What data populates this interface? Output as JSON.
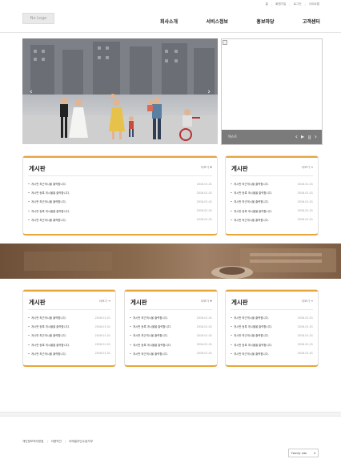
{
  "util_links": [
    "홈",
    "회원가입",
    "로그인",
    "사이트맵"
  ],
  "logo_text": "No Logo",
  "nav": [
    "회사소개",
    "서비스정보",
    "홍보마당",
    "고객센터"
  ],
  "slide_caption": "텍스트",
  "boards": [
    {
      "title": "게시판",
      "more": "더보기 ✚",
      "items": [
        {
          "t": "게시판 최근게시물 출력합니다.",
          "d": "2016.01.01"
        },
        {
          "t": "게시판 등록 게시물을 출력합니다.",
          "d": "2016.01.01"
        },
        {
          "t": "게시판 최근게시물 출력합니다.",
          "d": "2016.01.01"
        },
        {
          "t": "게시판 등록 게시물을 출력합니다.",
          "d": "2016.01.01"
        },
        {
          "t": "게시판 최근게시물 출력합니다.",
          "d": "2016.01.01"
        }
      ]
    },
    {
      "title": "게시판",
      "more": "더보기 ➔",
      "items": [
        {
          "t": "게시판 최근게시물 출력합니다.",
          "d": "2016.01.01"
        },
        {
          "t": "게시판 등록 게시물을 출력합니다.",
          "d": "2016.01.01"
        },
        {
          "t": "게시판 최근게시물 출력합니다.",
          "d": "2016.01.01"
        },
        {
          "t": "게시판 등록 게시물을 출력합니다.",
          "d": "2016.01.01"
        },
        {
          "t": "게시판 최근게시물 출력합니다.",
          "d": "2016.01.01"
        }
      ]
    },
    {
      "title": "게시판",
      "more": "더보기 ➔",
      "items": [
        {
          "t": "게시판 최근게시물 출력합니다.",
          "d": "2016.01.01"
        },
        {
          "t": "게시판 등록 게시물을 출력합니다.",
          "d": "2016.01.01"
        },
        {
          "t": "게시판 최근게시물 출력합니다.",
          "d": "2016.01.01"
        },
        {
          "t": "게시판 등록 게시물을 출력합니다.",
          "d": "2016.01.01"
        },
        {
          "t": "게시판 최근게시물 출력합니다.",
          "d": "2016.01.01"
        }
      ]
    },
    {
      "title": "게시판",
      "more": "더보기 ✚",
      "items": [
        {
          "t": "게시판 최근게시물 출력합니다.",
          "d": "2016.01.01"
        },
        {
          "t": "게시판 등록 게시물을 출력합니다.",
          "d": "2016.01.01"
        },
        {
          "t": "게시판 최근게시물 출력합니다.",
          "d": "2016.01.01"
        },
        {
          "t": "게시판 등록 게시물을 출력합니다.",
          "d": "2016.01.01"
        },
        {
          "t": "게시판 최근게시물 출력합니다.",
          "d": "2016.01.01"
        }
      ]
    },
    {
      "title": "게시판",
      "more": "더보기 ➔",
      "items": [
        {
          "t": "게시판 최근게시물 출력합니다.",
          "d": "2016.01.01"
        },
        {
          "t": "게시판 등록 게시물을 출력합니다.",
          "d": "2016.01.01"
        },
        {
          "t": "게시판 최근게시물 출력합니다.",
          "d": "2016.01.01"
        },
        {
          "t": "게시판 등록 게시물을 출력합니다.",
          "d": "2016.01.01"
        },
        {
          "t": "게시판 최근게시물 출력합니다.",
          "d": "2016.01.01"
        }
      ]
    }
  ],
  "footer_links": [
    "개인정보처리방침",
    "이용약관",
    "이메일무단수집거부"
  ],
  "family_label": "Family site",
  "colors": {
    "accent": "#e8a53a",
    "band": "#7d5e45",
    "slide_bar": "#7b7b7b"
  }
}
